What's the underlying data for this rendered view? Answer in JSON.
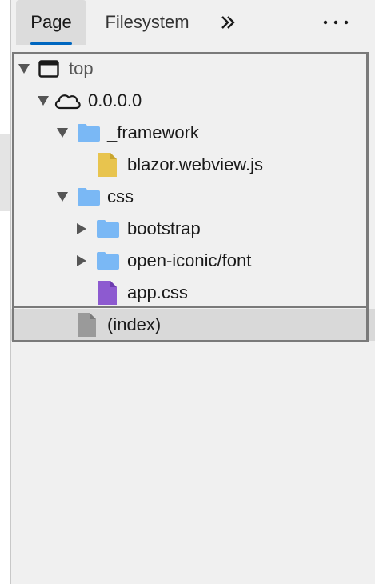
{
  "toolbar": {
    "tabs": [
      {
        "label": "Page",
        "active": true
      },
      {
        "label": "Filesystem",
        "active": false
      }
    ]
  },
  "tree": {
    "items": [
      {
        "label": "top",
        "icon": "frame-window-icon",
        "expanded": true
      },
      {
        "label": "0.0.0.0",
        "icon": "cloud-icon",
        "expanded": true
      },
      {
        "label": "_framework",
        "icon": "folder-icon",
        "expanded": true
      },
      {
        "label": "blazor.webview.js",
        "icon": "js-file-icon"
      },
      {
        "label": "css",
        "icon": "folder-icon",
        "expanded": true
      },
      {
        "label": "bootstrap",
        "icon": "folder-icon",
        "expanded": false
      },
      {
        "label": "open-iconic/font",
        "icon": "folder-icon",
        "expanded": false
      },
      {
        "label": "app.css",
        "icon": "css-file-icon"
      },
      {
        "label": "(index)",
        "icon": "document-file-icon",
        "selected": true
      }
    ]
  },
  "colors": {
    "accent": "#0067c0",
    "folder": "#7ab8f5",
    "js_file": "#e8c44e",
    "css_file": "#8d5ad0",
    "doc_file": "#9a9a9a"
  }
}
